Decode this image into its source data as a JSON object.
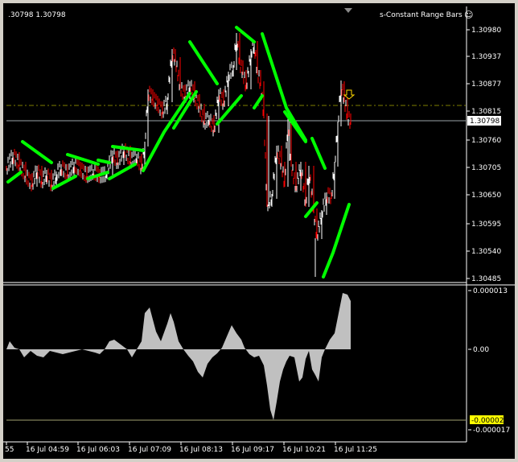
{
  "header": {
    "ohlc_text": ".30798 1.30798",
    "indicator_name": "s-Constant Range Bars",
    "smiley": "☺"
  },
  "price_axis": {
    "ticks": [
      "1.30980",
      "1.30937",
      "1.30877",
      "1.30815",
      "1.30760",
      "1.30705",
      "1.30650",
      "1.30595",
      "1.30540",
      "1.30485"
    ],
    "current_price": "1.30798"
  },
  "osc_axis": {
    "top": "0.000013",
    "zero": "0.00",
    "highlight": "-0.00002",
    "bottom": "-0.000017"
  },
  "time_axis": [
    "55",
    "16 Jul 04:59",
    "16 Jul 06:03",
    "16 Jul 07:09",
    "16 Jul 08:13",
    "16 Jul 09:17",
    "16 Jul 10:21",
    "16 Jul 11:25"
  ],
  "colors": {
    "background": "#000000",
    "bull_candle": "#ffffff",
    "bear_candle": "#ff0000",
    "band": "#00ff00",
    "level_line": "#808000",
    "arrow": "#ffd700",
    "histogram": "#c0c0c0",
    "highlight_box": "#ffff00"
  },
  "icons": {
    "smiley": "smiley-icon",
    "arrow": "down-arrow-icon",
    "scroll_marker": "scroll-triangle-icon"
  }
}
